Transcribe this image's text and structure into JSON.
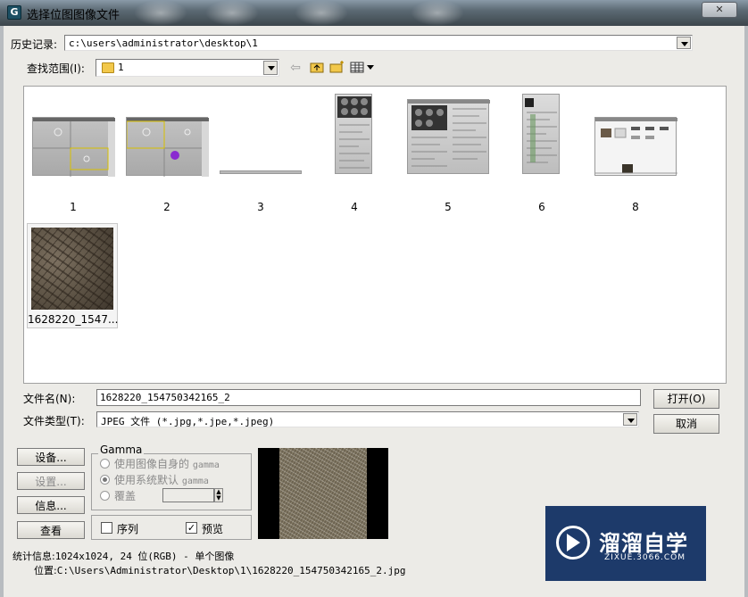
{
  "window": {
    "title": "选择位图图像文件",
    "icon": "3dsmax-icon"
  },
  "history": {
    "label": "历史记录:",
    "value": "c:\\users\\administrator\\desktop\\1"
  },
  "lookin": {
    "label": "查找范围(I):",
    "value": "1"
  },
  "toolbar": [
    "back-arrow-icon",
    "up-folder-icon",
    "new-folder-icon",
    "view-menu-icon"
  ],
  "files": [
    {
      "name": "1",
      "kind": "viewport"
    },
    {
      "name": "2",
      "kind": "viewport"
    },
    {
      "name": "3",
      "kind": "strip"
    },
    {
      "name": "4",
      "kind": "panel"
    },
    {
      "name": "5",
      "kind": "panel-wide"
    },
    {
      "name": "6",
      "kind": "panel"
    },
    {
      "name": "8",
      "kind": "window"
    },
    {
      "name": "1628220_1547...",
      "kind": "texture"
    }
  ],
  "filename": {
    "label": "文件名(N):",
    "value": "1628220_154750342165_2"
  },
  "filetype": {
    "label": "文件类型(T):",
    "value": "JPEG 文件 (*.jpg,*.jpe,*.jpeg)"
  },
  "buttons": {
    "open": "打开(O)",
    "cancel": "取消",
    "setup": "设备...",
    "settings": "设置...",
    "info": "信息...",
    "view": "查看"
  },
  "gamma": {
    "title": "Gamma",
    "own": {
      "label": "使用图像自身的",
      "suffix": "gamma"
    },
    "system": {
      "label": "使用系统默认",
      "suffix": "gamma"
    },
    "override": {
      "label": "覆盖"
    }
  },
  "checks": {
    "sequence": "序列",
    "preview": "预览"
  },
  "stats": {
    "label": "统计信息:",
    "value": "1024x1024, 24 位(RGB) - 单个图像",
    "location_label": "位置:",
    "location": "C:\\Users\\Administrator\\Desktop\\1\\1628220_154750342165_2.jpg"
  },
  "watermark": {
    "cn": "溜溜自学",
    "en": "ZIXUE.3066.COM"
  }
}
